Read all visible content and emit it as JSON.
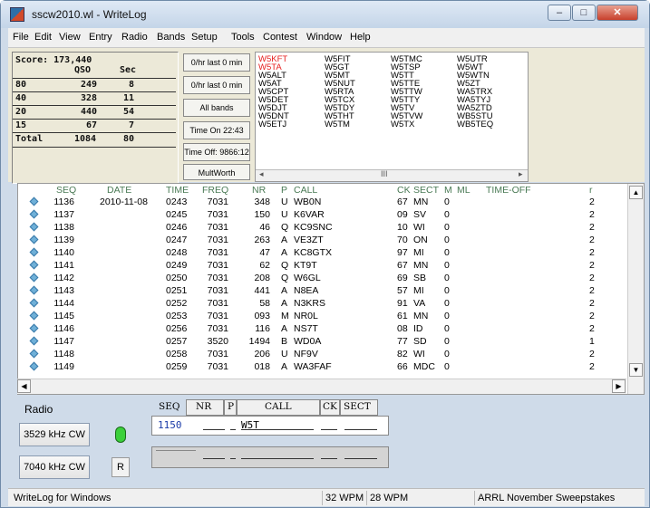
{
  "window": {
    "title": "sscw2010.wl - WriteLog",
    "minimize": "–",
    "maximize": "□",
    "close": "✕"
  },
  "menu": [
    "File",
    "Edit",
    "View",
    "Entry",
    "Radio",
    "Bands",
    "Setup",
    "Tools",
    "Contest",
    "Window",
    "Help"
  ],
  "score": {
    "title": "Score: 173,440",
    "header_qso": "QSO",
    "header_sec": "Sec",
    "rows": [
      {
        "band": "80",
        "qso": "249",
        "sec": "8"
      },
      {
        "band": "40",
        "qso": "328",
        "sec": "11"
      },
      {
        "band": "20",
        "qso": "440",
        "sec": "54"
      },
      {
        "band": "15",
        "qso": "67",
        "sec": "7"
      },
      {
        "band": "Total",
        "qso": "1084",
        "sec": "80"
      }
    ]
  },
  "rate_buttons": [
    "0/hr last  0 min",
    "0/hr last  0 min",
    "All bands",
    "Time On 22:43",
    "Time Off: 9866:12",
    "MultWorth"
  ],
  "callsigns": {
    "col1": [
      "W5KFT",
      "W5TA",
      "W5ALT",
      "W5AT",
      "W5CPT",
      "W5DET",
      "W5DJT",
      "W5DNT",
      "W5ETJ"
    ],
    "col2": [
      "W5FIT",
      "W5GT",
      "W5MT",
      "W5NUT",
      "W5RTA",
      "W5TCX",
      "W5TDY",
      "W5THT",
      "W5TM"
    ],
    "col3": [
      "W5TMC",
      "W5TSP",
      "W5TT",
      "W5TTE",
      "W5TTW",
      "W5TTY",
      "W5TV",
      "W5TVW",
      "W5TX"
    ],
    "col4": [
      "W5UTR",
      "W5WT",
      "W5WTN",
      "W5ZT",
      "WA5TRX",
      "WA5TYJ",
      "WA5ZTD",
      "WB5STU",
      "WB5TEQ"
    ],
    "red": [
      "W5KFT",
      "W5TA"
    ],
    "scroll_left": "◂",
    "scroll_mid": "III",
    "scroll_right": "▸"
  },
  "log": {
    "headers": [
      "SEQ",
      "DATE",
      "TIME",
      "FREQ",
      "NR",
      "P",
      "CALL",
      "CK",
      "SECT",
      "M",
      "ML",
      "TIME-OFF",
      "r"
    ],
    "rows": [
      [
        "1136",
        "2010-11-08",
        "0243",
        "7031",
        "348",
        "U",
        "WB0N",
        "67",
        "MN",
        "0",
        "",
        "",
        "2"
      ],
      [
        "1137",
        "",
        "0245",
        "7031",
        "150",
        "U",
        "K6VAR",
        "09",
        "SV",
        "0",
        "",
        "",
        "2"
      ],
      [
        "1138",
        "",
        "0246",
        "7031",
        "46",
        "Q",
        "KC9SNC",
        "10",
        "WI",
        "0",
        "",
        "",
        "2"
      ],
      [
        "1139",
        "",
        "0247",
        "7031",
        "263",
        "A",
        "VE3ZT",
        "70",
        "ON",
        "0",
        "",
        "",
        "2"
      ],
      [
        "1140",
        "",
        "0248",
        "7031",
        "47",
        "A",
        "KC8GTX",
        "97",
        "MI",
        "0",
        "",
        "",
        "2"
      ],
      [
        "1141",
        "",
        "0249",
        "7031",
        "62",
        "Q",
        "KT9T",
        "67",
        "MN",
        "0",
        "",
        "",
        "2"
      ],
      [
        "1142",
        "",
        "0250",
        "7031",
        "208",
        "Q",
        "W6GL",
        "69",
        "SB",
        "0",
        "",
        "",
        "2"
      ],
      [
        "1143",
        "",
        "0251",
        "7031",
        "441",
        "A",
        "N8EA",
        "57",
        "MI",
        "0",
        "",
        "",
        "2"
      ],
      [
        "1144",
        "",
        "0252",
        "7031",
        "58",
        "A",
        "N3KRS",
        "91",
        "VA",
        "0",
        "",
        "",
        "2"
      ],
      [
        "1145",
        "",
        "0253",
        "7031",
        "093",
        "M",
        "NR0L",
        "61",
        "MN",
        "0",
        "",
        "",
        "2"
      ],
      [
        "1146",
        "",
        "0256",
        "7031",
        "116",
        "A",
        "NS7T",
        "08",
        "ID",
        "0",
        "",
        "",
        "2"
      ],
      [
        "1147",
        "",
        "0257",
        "3520",
        "1494",
        "B",
        "WD0A",
        "77",
        "SD",
        "0",
        "",
        "",
        "1"
      ],
      [
        "1148",
        "",
        "0258",
        "7031",
        "206",
        "U",
        "NF9V",
        "82",
        "WI",
        "0",
        "",
        "",
        "2"
      ],
      [
        "1149",
        "",
        "0259",
        "7031",
        "018",
        "A",
        "WA3FAF",
        "66",
        "MDC",
        "0",
        "",
        "",
        "2"
      ]
    ]
  },
  "entry": {
    "radio_label": "Radio",
    "radio1": "3529 kHz CW",
    "radio2": "7040 kHz CW",
    "r_label": "R",
    "headers": [
      "SEQ",
      "NR",
      "P",
      "CALL",
      "CK",
      "SECT"
    ],
    "seq": "1150",
    "call": "W5T"
  },
  "status": {
    "left": "WriteLog for Windows",
    "wpm1": "32 WPM",
    "wpm2": "28 WPM",
    "contest": "ARRL November Sweepstakes"
  }
}
